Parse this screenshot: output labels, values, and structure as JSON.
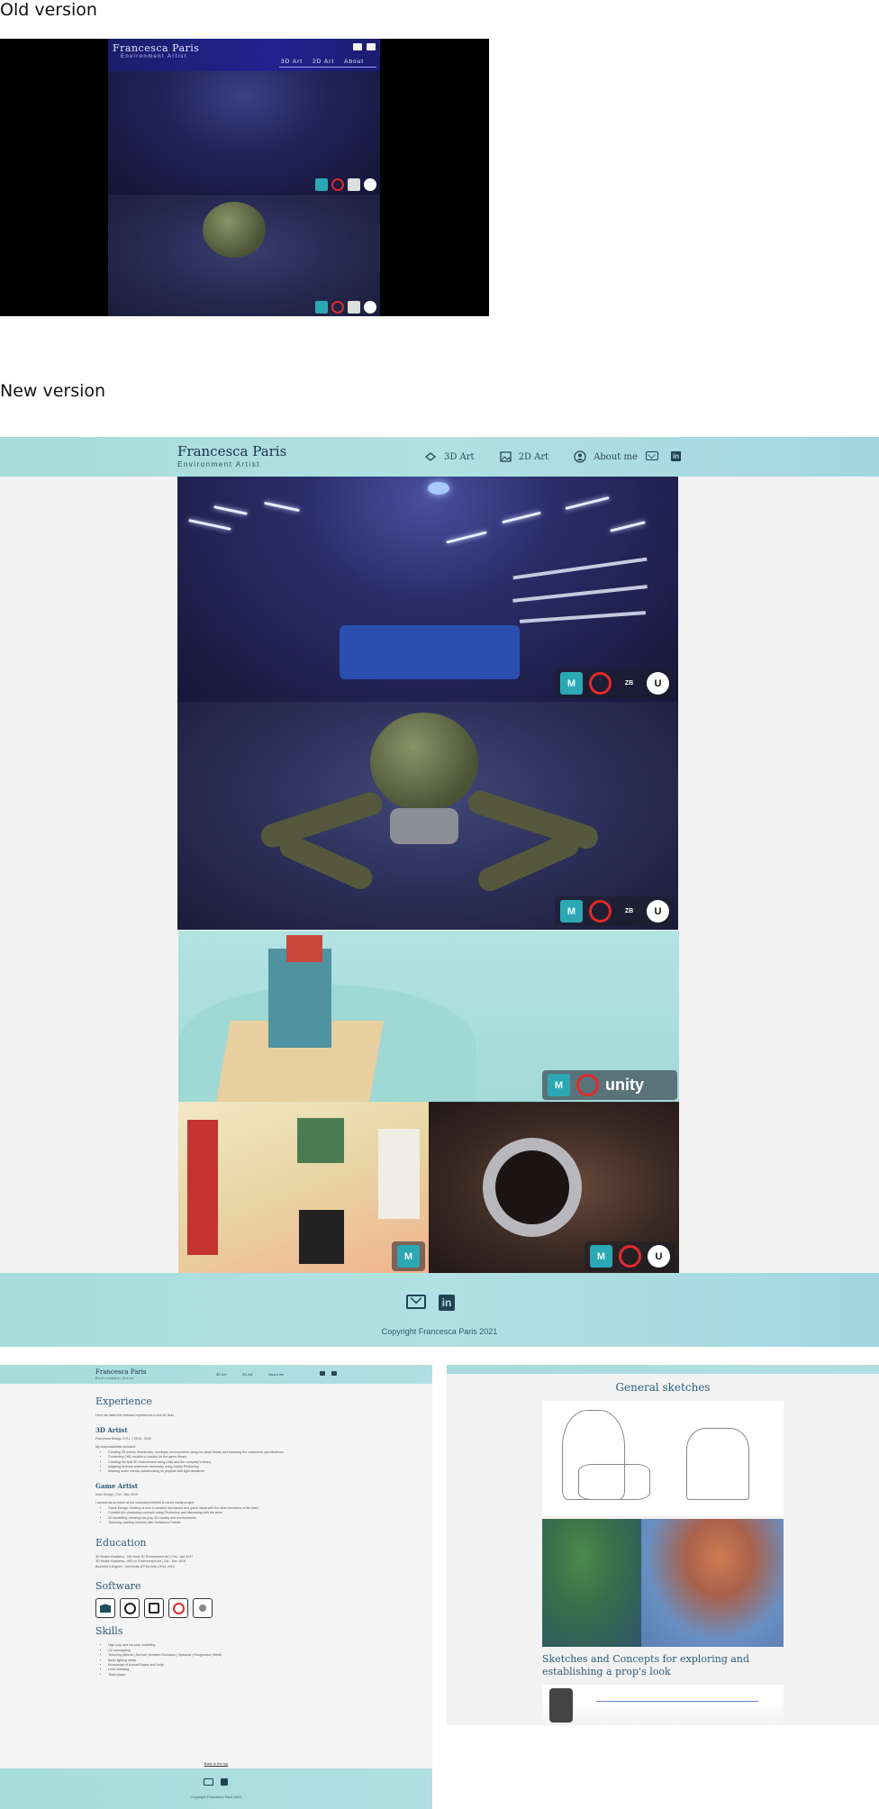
{
  "labels": {
    "old_version": "Old version",
    "new_version": "New version"
  },
  "old_site": {
    "logo": "Francesca Paris",
    "subtitle": "Environment Artist",
    "nav": [
      "3D Art",
      "2D Art",
      "About"
    ]
  },
  "new_site": {
    "brand": "Francesca Paris",
    "subtitle": "Environment Artist",
    "nav": [
      {
        "label": "3D Art",
        "icon": "cube-icon"
      },
      {
        "label": "2D Art",
        "icon": "image-icon"
      },
      {
        "label": "About me",
        "icon": "user-icon"
      }
    ],
    "social": [
      "mail-icon",
      "linkedin-icon"
    ],
    "software_badges_room": [
      "M",
      "S",
      "Z",
      "U"
    ],
    "software_badges_robot": [
      "M",
      "S",
      "Z",
      "U"
    ],
    "software_badges_island": [
      "M",
      "S",
      "unity"
    ],
    "software_badges_kid": [
      "M"
    ],
    "software_badges_coffee": [
      "M",
      "S",
      "U"
    ],
    "copyright": "Copyright Francesca Paris 2021"
  },
  "resume": {
    "brand": "Francesca Paris",
    "subtitle": "Environment Artist",
    "nav": [
      "3D Art",
      "2D Art",
      "About me"
    ],
    "experience_title": "Experience",
    "experience_intro": "Here are listed the relevant experiences in the 3D field",
    "jobs": [
      {
        "title": "3D Artist",
        "meta": "Francesca Design S.R.L. | 2018 - 2020",
        "intro": "My responsibilities included:",
        "bullets": [
          "Creating 3D assets, thumbnails, mockups, environments using our asset library and following the customers' specifications",
          "Converting CAD models to models for the game library",
          "Creating the final 3D environment using Unity and the company's library",
          "Adapting textures whenever necessary using Adobe Photoshop",
          "Working under clients, collaborating on projects with tight deadlines"
        ]
      },
      {
        "title": "Game Artist",
        "meta": "Indie Design | Oct - Dec 2019",
        "intro": "I worked as an intern at the company's Mobile & mixed reality project",
        "bullets": [
          "Game Design: thinking of new & creative mechanics and game ideas with the other members of the team",
          "Concept Art: producing concepts using Photoshop and discussing with the team",
          "3D Modelling: creating low-poly 3D models and environments",
          "Texturing: painting textures with Substance Painter"
        ]
      }
    ],
    "education_title": "Education",
    "education": [
      "3D Motion Academy - BA Hons 3D Environment Art | Feb - Apr 2017",
      "3D Motion Academy - MSc in Environment Art | Oct - Dec 2018",
      "Bachelor's Degree - University of Fine Arts | 2014-2016"
    ],
    "software_title": "Software",
    "software": [
      "maya-icon",
      "unreal-icon",
      "substance-designer-icon",
      "substance-painter-icon",
      "blender-icon"
    ],
    "skills_title": "Skills",
    "skills": [
      "High poly and low poly modelling",
      "UV unwrapping",
      "Texturing (Albedo | Normal | Ambient Occlusion | Specular | Roughness | Metal)",
      "Basic lighting setup",
      "Knowledge of Unreal Engine and Unity",
      "Level dressing",
      "Team player"
    ],
    "back_to_top": "Back to the top",
    "copyright": "Copyright Francesca Paris 2021"
  },
  "sketches": {
    "title": "General sketches",
    "caption": "Sketches and Concepts for exploring and establishing a prop's look"
  },
  "colors": {
    "header_teal": "#a6dcdc",
    "accent_blue": "#2a5a7a",
    "old_blue": "#222290"
  }
}
